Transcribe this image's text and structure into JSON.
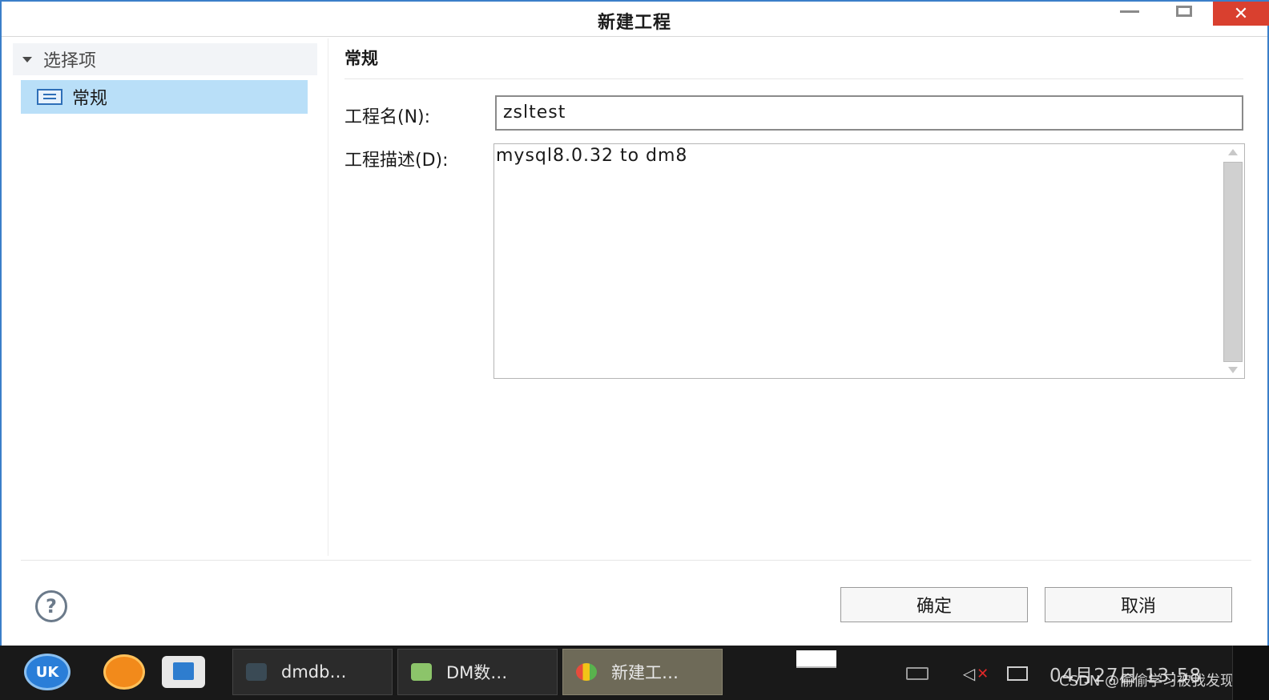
{
  "window": {
    "title": "新建工程",
    "close_glyph": "✕"
  },
  "tree": {
    "header": "选择项",
    "items": [
      {
        "label": "常规",
        "selected": true
      }
    ]
  },
  "panel": {
    "section_title": "常规",
    "name_label": "工程名(N):",
    "name_value": "zsltest",
    "desc_label": "工程描述(D):",
    "desc_value": "mysql8.0.32 to dm8"
  },
  "buttons": {
    "help_glyph": "?",
    "ok": "确定",
    "cancel": "取消"
  },
  "taskbar": {
    "start_label": "UK",
    "tasks": [
      {
        "label": "dmdb…"
      },
      {
        "label": "DM数…"
      },
      {
        "label": "新建工…",
        "active": true
      }
    ],
    "clock": "04月27日 13:58",
    "watermark": "CSDN @偷偷学习被我发现"
  },
  "colors": {
    "accent": "#3b7fc9",
    "selection": "#b9dff8",
    "close": "#d9402f",
    "taskbar": "#191919"
  }
}
